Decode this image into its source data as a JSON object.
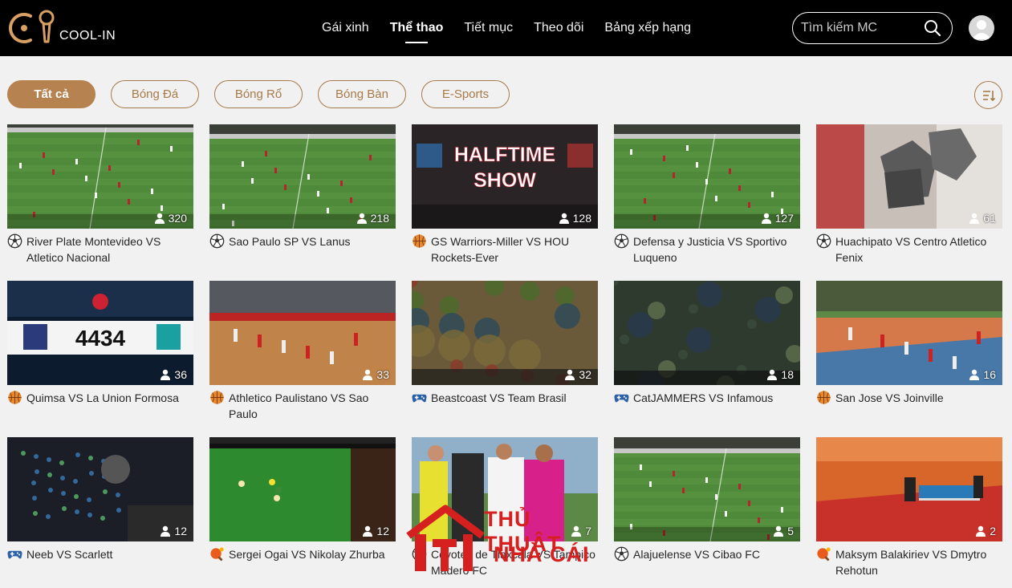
{
  "header": {
    "logo_text": "COOL-IN",
    "nav": [
      {
        "label": "Gái xinh",
        "active": false
      },
      {
        "label": "Thể thao",
        "active": true
      },
      {
        "label": "Tiết mục",
        "active": false
      },
      {
        "label": "Theo dõi",
        "active": false
      },
      {
        "label": "Bảng xếp hạng",
        "active": false
      }
    ],
    "search_placeholder": "Tìm kiếm MC"
  },
  "filters": [
    {
      "label": "Tất cả",
      "active": true
    },
    {
      "label": "Bóng Đá",
      "active": false
    },
    {
      "label": "Bóng Rổ",
      "active": false
    },
    {
      "label": "Bóng Bàn",
      "active": false
    },
    {
      "label": "E-Sports",
      "active": false
    }
  ],
  "streams": [
    {
      "title": "River Plate Montevideo VS Atletico Nacional",
      "viewers": "320",
      "sport": "soccer-icon",
      "thumb": "pitch"
    },
    {
      "title": "Sao Paulo SP VS Lanus",
      "viewers": "218",
      "sport": "soccer-icon",
      "thumb": "pitch"
    },
    {
      "title": "GS Warriors-Miller VS HOU Rockets-Ever",
      "viewers": "128",
      "sport": "basketball-icon",
      "thumb": "halftime"
    },
    {
      "title": "Defensa y Justicia VS Sportivo Luqueno",
      "viewers": "127",
      "sport": "soccer-icon",
      "thumb": "pitch"
    },
    {
      "title": "Huachipato VS Centro Atletico Fenix",
      "viewers": "61",
      "sport": "soccer-icon",
      "thumb": "robot"
    },
    {
      "title": "Quimsa VS La Union Formosa",
      "viewers": "36",
      "sport": "basketball-icon",
      "thumb": "score"
    },
    {
      "title": "Athletico Paulistano VS Sao Paulo",
      "viewers": "33",
      "sport": "basketball-icon",
      "thumb": "court"
    },
    {
      "title": "Beastcoast VS Team Brasil",
      "viewers": "32",
      "sport": "gamepad-icon",
      "thumb": "moba"
    },
    {
      "title": "CatJAMMERS VS Infamous",
      "viewers": "18",
      "sport": "gamepad-icon",
      "thumb": "moba-dark"
    },
    {
      "title": "San Jose VS Joinville",
      "viewers": "16",
      "sport": "basketball-icon",
      "thumb": "court-green"
    },
    {
      "title": "Neeb VS Scarlett",
      "viewers": "12",
      "sport": "gamepad-icon",
      "thumb": "rts"
    },
    {
      "title": "Sergei Ogai VS Nikolay Zhurba",
      "viewers": "12",
      "sport": "pingpong-icon",
      "thumb": "snooker"
    },
    {
      "title": "Coyotes de Tlaxcala VS Tampico Madero FC",
      "viewers": "7",
      "sport": "soccer-icon",
      "thumb": "players"
    },
    {
      "title": "Alajuelense VS Cibao FC",
      "viewers": "5",
      "sport": "soccer-icon",
      "thumb": "pitch-wide"
    },
    {
      "title": "Maksym Balakiriev VS Dmytro Rehotun",
      "viewers": "2",
      "sport": "pingpong-icon",
      "thumb": "tabletennis"
    }
  ],
  "thumb_texts": {
    "halftime_line1": "HALFTIME",
    "halftime_line2": "SHOW",
    "score": "4434"
  },
  "watermark": {
    "line1": "THỦ THUẬT",
    "line2": "NHÀ CÁI"
  },
  "colors": {
    "accent": "#b6824f",
    "header_bg": "#000000",
    "page_bg": "#f1f1f1"
  }
}
